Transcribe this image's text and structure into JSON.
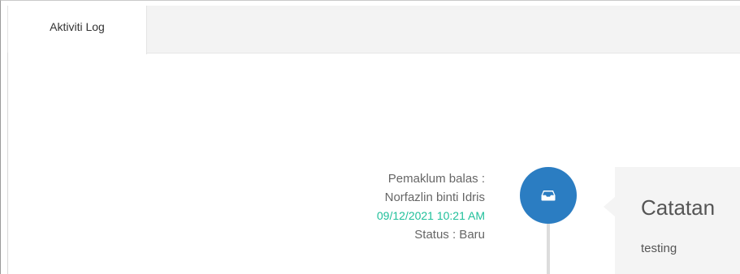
{
  "tabs": [
    {
      "label": "Aktiviti Log",
      "active": true
    }
  ],
  "timeline": {
    "entry": {
      "label_line1": "Pemaklum balas :",
      "name": "Norfazlin binti Idris",
      "datetime": "09/12/2021 10:21 AM",
      "status": "Status : Baru",
      "icon": "inbox-icon",
      "icon_color": "#2b7dc2",
      "datetime_color": "#1fbf9a",
      "card": {
        "title": "Catatan",
        "body": "testing"
      }
    }
  }
}
